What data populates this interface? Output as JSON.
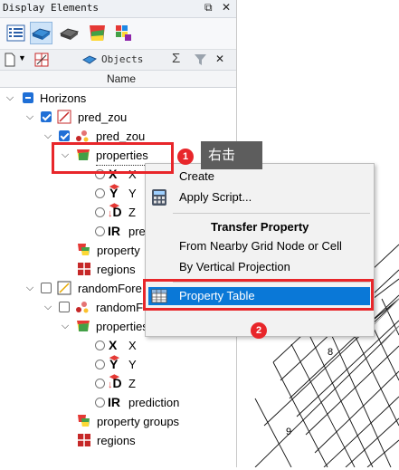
{
  "panel": {
    "title": "Display Elements",
    "pin_glyph": "⧉",
    "close_glyph": "✕",
    "objects_label": "Objects",
    "column_header": "Name"
  },
  "tree": {
    "horizons": "Horizons",
    "pred_zou": "pred_zou",
    "pred_zou_child": "pred_zou",
    "properties_1": "properties",
    "x_1": "X",
    "y_1": "Y",
    "z_1": "Z",
    "pred_1": "pre",
    "property_groups_1": "property",
    "regions_1": "regions",
    "randomfore": "randomFore",
    "randomf_child": "randomF",
    "properties_2": "properties",
    "x_2": "X",
    "y_2": "Y",
    "z_2": "Z",
    "pred_2": "prediction",
    "property_groups_2": "property groups",
    "regions_2": "regions"
  },
  "context_menu": {
    "create": "Create",
    "apply_script": "Apply Script...",
    "transfer_header": "Transfer Property",
    "from_nearby": "From Nearby Grid Node or Cell",
    "by_vertical": "By Vertical Projection",
    "property_table": "Property Table"
  },
  "annotations": {
    "tooltip": "右击",
    "badge1": "1",
    "badge2": "2"
  },
  "grid_labels": {
    "label8": "8",
    "label9": "9"
  },
  "colors": {
    "accent_blue": "#1f6fd6",
    "highlight": "#0a78d7",
    "annotation_red": "#e8262a"
  }
}
